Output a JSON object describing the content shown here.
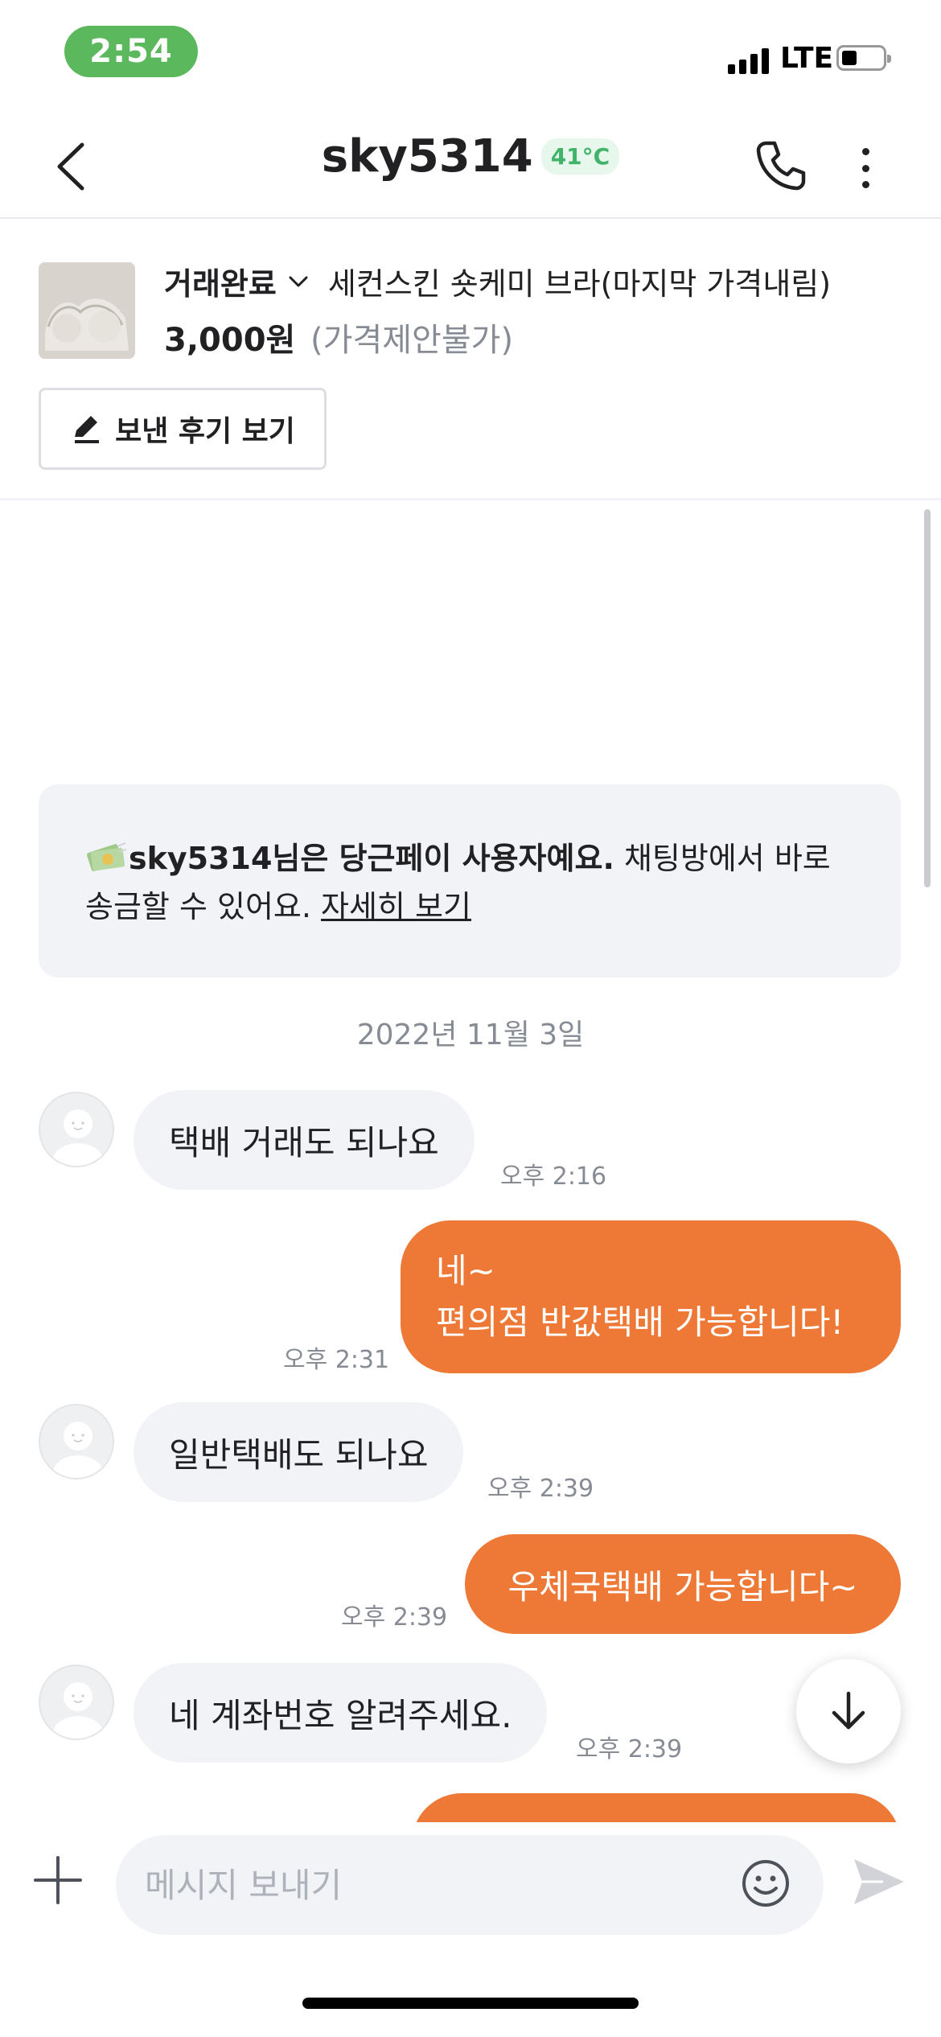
{
  "status_bar": {
    "time": "2:54",
    "network": "LTE"
  },
  "header": {
    "title": "sky5314",
    "temperature": "41°C"
  },
  "product": {
    "deal_status": "거래완료",
    "title": "세컨스킨 숏케미 브라(마지막 가격내림)",
    "price": "3,000원",
    "price_note": "(가격제안불가)",
    "review_button": "보낸 후기 보기"
  },
  "notice": {
    "name_bold": "sky5314님은 당근페이 사용자예요.",
    "text_line1": " 채팅방에서 바로",
    "text_line2": "송금할 수 있어요. ",
    "link": "자세히 보기"
  },
  "date_separator": "2022년 11월 3일",
  "messages": [
    {
      "direction": "incoming",
      "text": "택배 거래도 되나요",
      "time": "오후 2:16"
    },
    {
      "direction": "outgoing",
      "line1": "네~",
      "line2": "편의점 반값택배 가능합니다!",
      "time": "오후 2:31"
    },
    {
      "direction": "incoming",
      "text": "일반택배도 되나요",
      "time": "오후 2:39"
    },
    {
      "direction": "outgoing",
      "text": "우체국택배 가능합니다~",
      "time": "오후 2:39"
    },
    {
      "direction": "incoming",
      "text": "네 계좌번호 알려주세요.",
      "time": "오후 2:39"
    }
  ],
  "input": {
    "placeholder": "메시지 보내기"
  },
  "colors": {
    "accent": "#ee7836",
    "temperature": "#41b36b",
    "incoming_bubble": "#f2f3f6"
  },
  "icons": [
    "back-arrow-icon",
    "phone-icon",
    "more-vertical-icon",
    "chevron-down-icon",
    "pencil-icon",
    "money-icon",
    "arrow-down-icon",
    "plus-icon",
    "emoji-icon",
    "send-icon"
  ]
}
